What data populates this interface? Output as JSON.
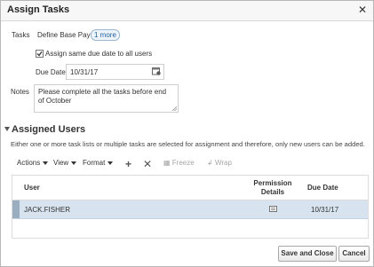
{
  "dialog": {
    "title": "Assign Tasks"
  },
  "tasks": {
    "label": "Tasks",
    "value": "Define Base Pay",
    "more_link": "1 more"
  },
  "assign_same": {
    "label": "Assign same due date to all users",
    "checked": true
  },
  "due_date": {
    "label": "Due Date",
    "value": "10/31/17"
  },
  "notes": {
    "label": "Notes",
    "value": "Please complete all the tasks before end of October"
  },
  "assigned_users": {
    "heading": "Assigned Users",
    "info": "Either one or more task lists or multiple tasks are selected for assignment and therefore, only new users can be added.",
    "toolbar": {
      "actions": "Actions",
      "view": "View",
      "format": "Format",
      "freeze": "Freeze",
      "wrap": "Wrap"
    },
    "columns": {
      "user": "User",
      "permission_details": "Permission Details",
      "due_date": "Due Date"
    },
    "rows": [
      {
        "user": "JACK.FISHER",
        "due_date": "10/31/17"
      }
    ]
  },
  "buttons": {
    "save_close": "Save and Close",
    "cancel": "Cancel"
  }
}
